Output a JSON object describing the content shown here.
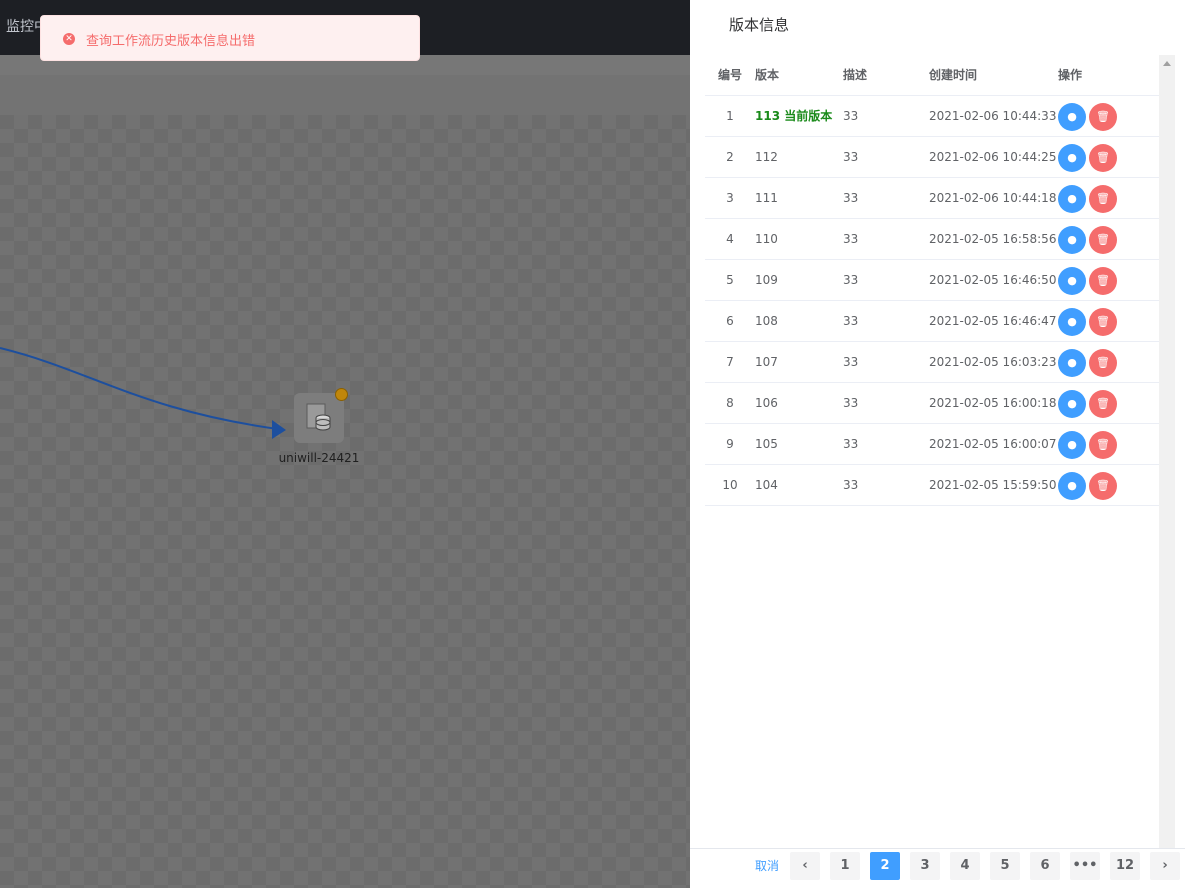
{
  "topbar": {
    "text": "监控中"
  },
  "toast": {
    "message": "查询工作流历史版本信息出错",
    "icon": "error-circle-icon"
  },
  "canvas": {
    "node_label": "uniwill-24421"
  },
  "drawer": {
    "title": "版本信息",
    "columns": {
      "no": "编号",
      "version": "版本",
      "desc": "描述",
      "time": "创建时间",
      "ops": "操作"
    },
    "rows": [
      {
        "no": "1",
        "version": "113 当前版本",
        "desc": "33",
        "time": "2021-02-06 10:44:33"
      },
      {
        "no": "2",
        "version": "112",
        "desc": "33",
        "time": "2021-02-06 10:44:25"
      },
      {
        "no": "3",
        "version": "111",
        "desc": "33",
        "time": "2021-02-06 10:44:18"
      },
      {
        "no": "4",
        "version": "110",
        "desc": "33",
        "time": "2021-02-05 16:58:56"
      },
      {
        "no": "5",
        "version": "109",
        "desc": "33",
        "time": "2021-02-05 16:46:50"
      },
      {
        "no": "6",
        "version": "108",
        "desc": "33",
        "time": "2021-02-05 16:46:47"
      },
      {
        "no": "7",
        "version": "107",
        "desc": "33",
        "time": "2021-02-05 16:03:23"
      },
      {
        "no": "8",
        "version": "106",
        "desc": "33",
        "time": "2021-02-05 16:00:18"
      },
      {
        "no": "9",
        "version": "105",
        "desc": "33",
        "time": "2021-02-05 16:00:07"
      },
      {
        "no": "10",
        "version": "104",
        "desc": "33",
        "time": "2021-02-05 15:59:50"
      }
    ],
    "footer": {
      "cancel": "取消",
      "prev": "‹",
      "next": "›",
      "pages": [
        "1",
        "2",
        "3",
        "4",
        "5",
        "6",
        "•••",
        "12"
      ],
      "current_page": "2"
    }
  },
  "colors": {
    "primary": "#409eff",
    "danger": "#f56c6c",
    "current_version": "#1a8a1a"
  }
}
